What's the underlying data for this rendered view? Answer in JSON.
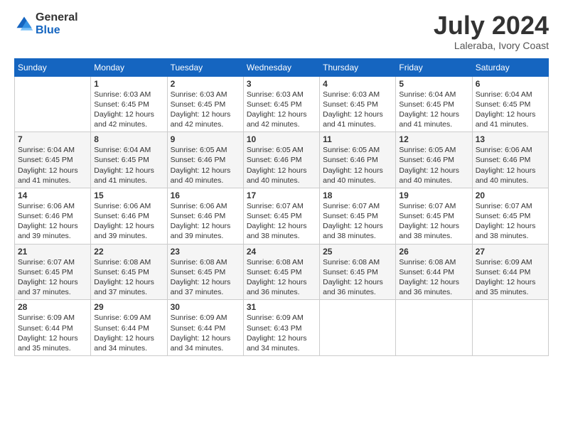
{
  "header": {
    "logo_general": "General",
    "logo_blue": "Blue",
    "title": "July 2024",
    "subtitle": "Laleraba, Ivory Coast"
  },
  "calendar": {
    "days_of_week": [
      "Sunday",
      "Monday",
      "Tuesday",
      "Wednesday",
      "Thursday",
      "Friday",
      "Saturday"
    ],
    "weeks": [
      [
        {
          "day": "",
          "info": ""
        },
        {
          "day": "1",
          "info": "Sunrise: 6:03 AM\nSunset: 6:45 PM\nDaylight: 12 hours\nand 42 minutes."
        },
        {
          "day": "2",
          "info": "Sunrise: 6:03 AM\nSunset: 6:45 PM\nDaylight: 12 hours\nand 42 minutes."
        },
        {
          "day": "3",
          "info": "Sunrise: 6:03 AM\nSunset: 6:45 PM\nDaylight: 12 hours\nand 42 minutes."
        },
        {
          "day": "4",
          "info": "Sunrise: 6:03 AM\nSunset: 6:45 PM\nDaylight: 12 hours\nand 41 minutes."
        },
        {
          "day": "5",
          "info": "Sunrise: 6:04 AM\nSunset: 6:45 PM\nDaylight: 12 hours\nand 41 minutes."
        },
        {
          "day": "6",
          "info": "Sunrise: 6:04 AM\nSunset: 6:45 PM\nDaylight: 12 hours\nand 41 minutes."
        }
      ],
      [
        {
          "day": "7",
          "info": "Sunrise: 6:04 AM\nSunset: 6:45 PM\nDaylight: 12 hours\nand 41 minutes."
        },
        {
          "day": "8",
          "info": "Sunrise: 6:04 AM\nSunset: 6:45 PM\nDaylight: 12 hours\nand 41 minutes."
        },
        {
          "day": "9",
          "info": "Sunrise: 6:05 AM\nSunset: 6:46 PM\nDaylight: 12 hours\nand 40 minutes."
        },
        {
          "day": "10",
          "info": "Sunrise: 6:05 AM\nSunset: 6:46 PM\nDaylight: 12 hours\nand 40 minutes."
        },
        {
          "day": "11",
          "info": "Sunrise: 6:05 AM\nSunset: 6:46 PM\nDaylight: 12 hours\nand 40 minutes."
        },
        {
          "day": "12",
          "info": "Sunrise: 6:05 AM\nSunset: 6:46 PM\nDaylight: 12 hours\nand 40 minutes."
        },
        {
          "day": "13",
          "info": "Sunrise: 6:06 AM\nSunset: 6:46 PM\nDaylight: 12 hours\nand 40 minutes."
        }
      ],
      [
        {
          "day": "14",
          "info": "Sunrise: 6:06 AM\nSunset: 6:46 PM\nDaylight: 12 hours\nand 39 minutes."
        },
        {
          "day": "15",
          "info": "Sunrise: 6:06 AM\nSunset: 6:46 PM\nDaylight: 12 hours\nand 39 minutes."
        },
        {
          "day": "16",
          "info": "Sunrise: 6:06 AM\nSunset: 6:46 PM\nDaylight: 12 hours\nand 39 minutes."
        },
        {
          "day": "17",
          "info": "Sunrise: 6:07 AM\nSunset: 6:45 PM\nDaylight: 12 hours\nand 38 minutes."
        },
        {
          "day": "18",
          "info": "Sunrise: 6:07 AM\nSunset: 6:45 PM\nDaylight: 12 hours\nand 38 minutes."
        },
        {
          "day": "19",
          "info": "Sunrise: 6:07 AM\nSunset: 6:45 PM\nDaylight: 12 hours\nand 38 minutes."
        },
        {
          "day": "20",
          "info": "Sunrise: 6:07 AM\nSunset: 6:45 PM\nDaylight: 12 hours\nand 38 minutes."
        }
      ],
      [
        {
          "day": "21",
          "info": "Sunrise: 6:07 AM\nSunset: 6:45 PM\nDaylight: 12 hours\nand 37 minutes."
        },
        {
          "day": "22",
          "info": "Sunrise: 6:08 AM\nSunset: 6:45 PM\nDaylight: 12 hours\nand 37 minutes."
        },
        {
          "day": "23",
          "info": "Sunrise: 6:08 AM\nSunset: 6:45 PM\nDaylight: 12 hours\nand 37 minutes."
        },
        {
          "day": "24",
          "info": "Sunrise: 6:08 AM\nSunset: 6:45 PM\nDaylight: 12 hours\nand 36 minutes."
        },
        {
          "day": "25",
          "info": "Sunrise: 6:08 AM\nSunset: 6:45 PM\nDaylight: 12 hours\nand 36 minutes."
        },
        {
          "day": "26",
          "info": "Sunrise: 6:08 AM\nSunset: 6:44 PM\nDaylight: 12 hours\nand 36 minutes."
        },
        {
          "day": "27",
          "info": "Sunrise: 6:09 AM\nSunset: 6:44 PM\nDaylight: 12 hours\nand 35 minutes."
        }
      ],
      [
        {
          "day": "28",
          "info": "Sunrise: 6:09 AM\nSunset: 6:44 PM\nDaylight: 12 hours\nand 35 minutes."
        },
        {
          "day": "29",
          "info": "Sunrise: 6:09 AM\nSunset: 6:44 PM\nDaylight: 12 hours\nand 34 minutes."
        },
        {
          "day": "30",
          "info": "Sunrise: 6:09 AM\nSunset: 6:44 PM\nDaylight: 12 hours\nand 34 minutes."
        },
        {
          "day": "31",
          "info": "Sunrise: 6:09 AM\nSunset: 6:43 PM\nDaylight: 12 hours\nand 34 minutes."
        },
        {
          "day": "",
          "info": ""
        },
        {
          "day": "",
          "info": ""
        },
        {
          "day": "",
          "info": ""
        }
      ]
    ]
  }
}
